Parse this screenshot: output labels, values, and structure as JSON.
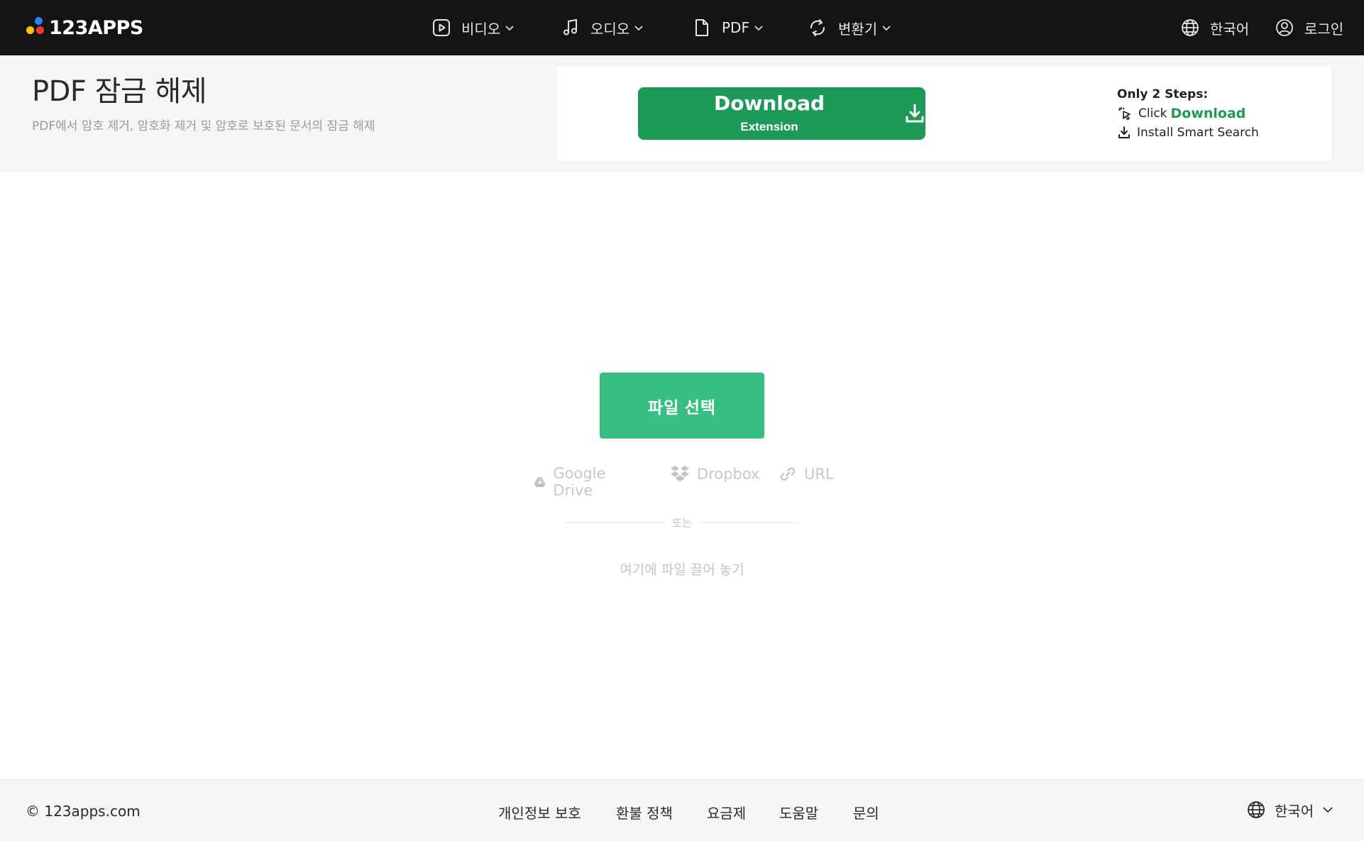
{
  "nav": {
    "logo_text": "123APPS",
    "video": {
      "label": "비디오",
      "icon": "video-play-icon"
    },
    "audio": {
      "label": "오디오",
      "icon": "music-note-icon"
    },
    "pdf": {
      "label": "PDF",
      "icon": "document-icon"
    },
    "converter": {
      "label": "변환기",
      "icon": "convert-arrows-icon"
    },
    "language": {
      "label": "한국어",
      "icon": "globe-icon"
    },
    "login": {
      "label": "로그인",
      "icon": "user-circle-icon"
    }
  },
  "header": {
    "title": "PDF 잠금 해제",
    "subtitle": "PDF에서 암호 제거, 암호화 제거 및 암호로 보호된 문서의 잠금 해제"
  },
  "promo": {
    "button_title": "Download",
    "button_subtitle": "Extension",
    "steps_heading": "Only 2 Steps:",
    "step1_prefix": "Click",
    "step1_highlight": "Download",
    "step2": "Install Smart Search",
    "accent_color": "#1d9a57"
  },
  "upload": {
    "choose_button": "파일 선택",
    "sources": {
      "google_drive": "Google Drive",
      "dropbox": "Dropbox",
      "url": "URL"
    },
    "divider_text": "또는",
    "drop_hint": "여기에 파일 끌어 놓기",
    "button_color": "#38bf82"
  },
  "footer": {
    "copyright": "© 123apps.com",
    "links": [
      "개인정보 보호",
      "환불 정책",
      "요금제",
      "도움말",
      "문의"
    ],
    "language": "한국어"
  }
}
